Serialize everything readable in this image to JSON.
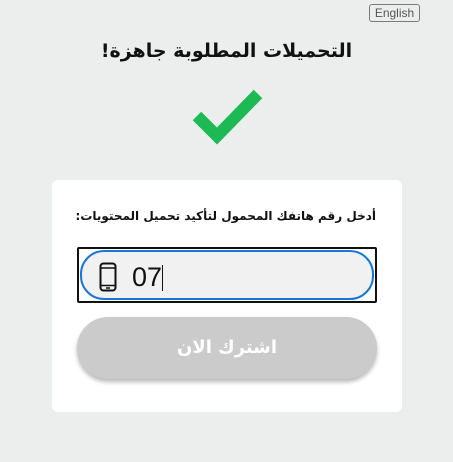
{
  "header": {
    "language_button": "English"
  },
  "main": {
    "title": "التحميلات المطلوبة جاهزة!",
    "success_icon": "checkmark-icon",
    "accent_color": "#1db954"
  },
  "form": {
    "instruction": "أدخل رقم هاتفك المحمول لتأكيد تحميل المحتويات:",
    "phone_icon": "mobile-phone-icon",
    "phone_value": "07",
    "focus_color": "#1877d2",
    "subscribe_label": "اشترك الان",
    "subscribe_color": "#cbcbcb"
  }
}
